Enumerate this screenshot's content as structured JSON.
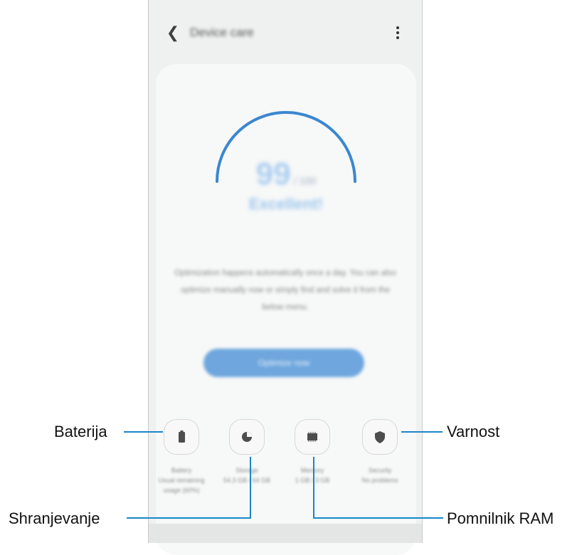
{
  "app": {
    "title": "Device care",
    "back_icon": "back-arrow-icon",
    "more_icon": "more-vert-icon"
  },
  "score": {
    "value": "99",
    "max": "/ 100",
    "status": "Excellent!",
    "gauge_color": "#3b87d0"
  },
  "description": "Optimization happens automatically once a day. You can also optimize manually now or simply find and solve it from the below menu.",
  "optimize_button": "Optimize now",
  "tiles": [
    {
      "name": "battery",
      "icon": "battery-icon",
      "label": "Battery",
      "sub": "Usual remaining usage (60%)"
    },
    {
      "name": "storage",
      "icon": "storage-pie-icon",
      "label": "Storage",
      "sub": "54.3 GB / 64 GB"
    },
    {
      "name": "memory",
      "icon": "memory-chip-icon",
      "label": "Memory",
      "sub": "1 GB / 3 GB"
    },
    {
      "name": "security",
      "icon": "shield-icon",
      "label": "Security",
      "sub": "No problems"
    }
  ],
  "callouts": {
    "battery": "Baterija",
    "storage": "Shranjevanje",
    "memory": "Pomnilnik RAM",
    "security": "Varnost",
    "line_color": "#1b86c9"
  }
}
